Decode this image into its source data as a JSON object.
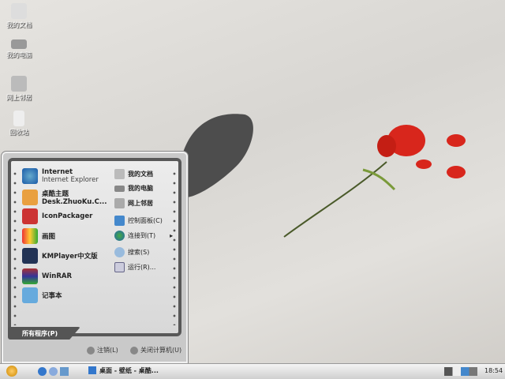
{
  "desktop_icons": [
    {
      "label": "我的文档",
      "icon": "documents-icon"
    },
    {
      "label": "我的电脑",
      "icon": "computer-icon"
    },
    {
      "label": "网上邻居",
      "icon": "network-icon"
    },
    {
      "label": "回收站",
      "icon": "recycle-bin-icon"
    }
  ],
  "start_menu": {
    "pinned": [
      {
        "title": "Internet",
        "subtitle": "Internet Explorer",
        "icon": "ie-icon"
      },
      {
        "title": "桌酷主题",
        "subtitle": "Desk.ZhuoKu.C...",
        "icon": "theme-icon"
      }
    ],
    "programs": [
      {
        "title": "IconPackager",
        "icon": "iconpackager-icon"
      },
      {
        "title": "画图",
        "icon": "paint-icon"
      },
      {
        "title": "KMPlayer中文版",
        "icon": "kmplayer-icon"
      },
      {
        "title": "WinRAR",
        "icon": "winrar-icon"
      },
      {
        "title": "记事本",
        "icon": "notepad-icon"
      }
    ],
    "right": [
      {
        "label": "我的文档",
        "icon": "documents-icon"
      },
      {
        "label": "我的电脑",
        "icon": "computer-icon"
      },
      {
        "label": "网上邻居",
        "icon": "network-icon"
      },
      {
        "label": "控制面板(C)",
        "icon": "control-panel-icon"
      },
      {
        "label": "连接到(T)",
        "icon": "connect-icon",
        "arrow": "▸"
      },
      {
        "label": "搜索(S)",
        "icon": "search-icon"
      },
      {
        "label": "运行(R)...",
        "icon": "run-icon"
      }
    ],
    "all_programs": "所有程序(P)",
    "logoff": "注销(L)",
    "shutdown": "关闭计算机(U)"
  },
  "taskbar": {
    "window_title": "桌面 - 壁纸 - 桌酷...",
    "clock": "18:54"
  }
}
